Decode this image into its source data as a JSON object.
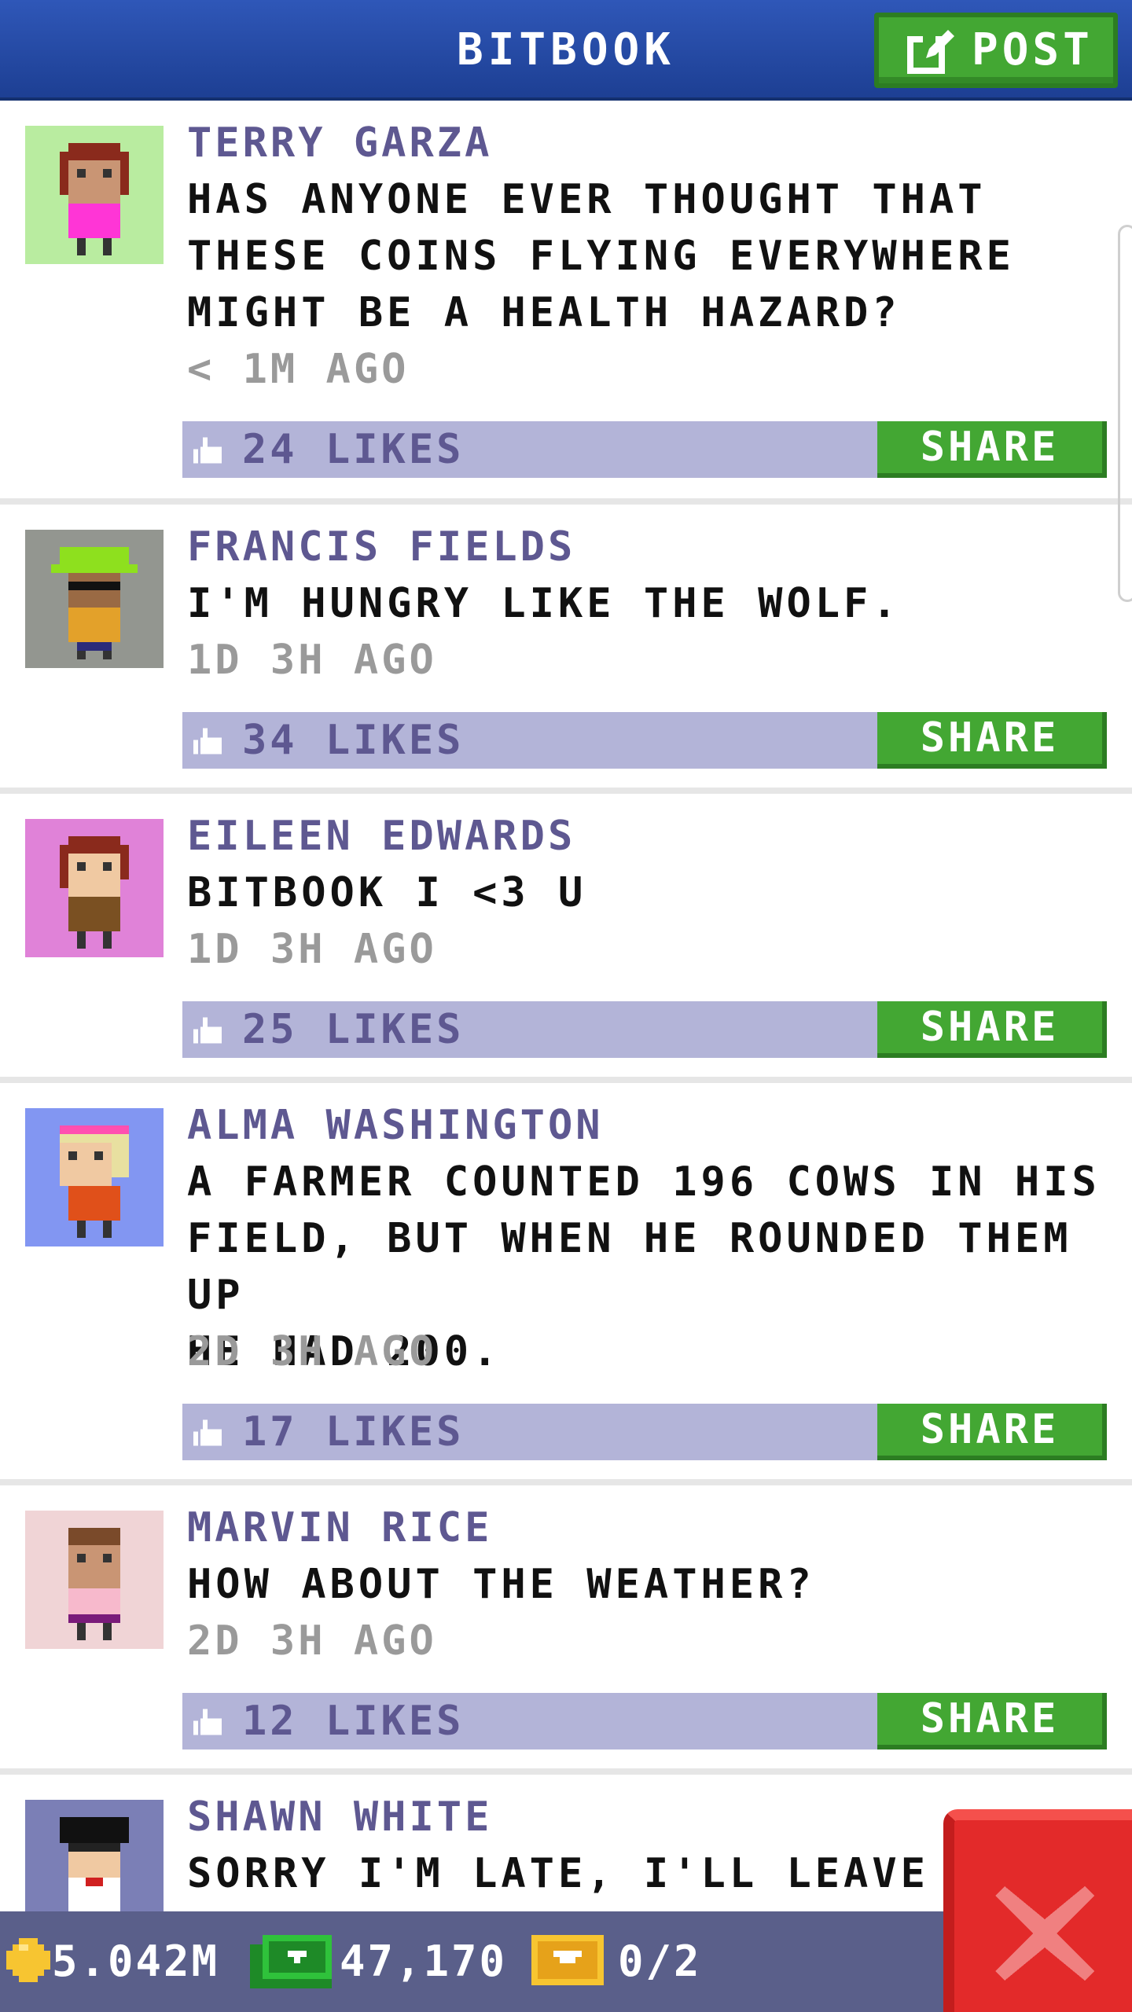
{
  "header": {
    "title": "BITBOOK",
    "post_label": "POST"
  },
  "colors": {
    "header_blue": "#2f57b8",
    "button_green": "#43a733",
    "author_purple": "#5e5891",
    "like_bar": "#b3b4d8",
    "time_gray": "#9a9a9a",
    "close_red": "#e32a2a"
  },
  "posts": [
    {
      "author": "TERRY GARZA",
      "message": "HAS ANYONE EVER THOUGHT THAT\nTHESE COINS FLYING EVERYWHERE\nMIGHT BE A HEALTH HAZARD?",
      "time": "< 1M AGO",
      "likes": "24 LIKES",
      "share": "SHARE",
      "avatar_bg": "#b9eca0"
    },
    {
      "author": "FRANCIS FIELDS",
      "message": "I'M HUNGRY LIKE THE WOLF.",
      "time": "1D 3H AGO",
      "likes": "34 LIKES",
      "share": "SHARE",
      "avatar_bg": "#939690"
    },
    {
      "author": "EILEEN EDWARDS",
      "message": "BITBOOK I <3 U",
      "time": "1D 3H AGO",
      "likes": "25 LIKES",
      "share": "SHARE",
      "avatar_bg": "#e082d8"
    },
    {
      "author": "ALMA WASHINGTON",
      "message": "A FARMER COUNTED 196 COWS IN HIS\nFIELD, BUT WHEN HE ROUNDED THEM UP\nHE HAD 200.",
      "time": "2D 3H AGO",
      "likes": "17 LIKES",
      "share": "SHARE",
      "avatar_bg": "#8296f2"
    },
    {
      "author": "MARVIN RICE",
      "message": "HOW ABOUT THE WEATHER?",
      "time": "2D 3H AGO",
      "likes": "12 LIKES",
      "share": "SHARE",
      "avatar_bg": "#f0d4d6"
    },
    {
      "author": "SHAWN WHITE",
      "message": "SORRY I'M LATE, I'LL LEAVE EARL",
      "avatar_bg": "#7b7fb6"
    }
  ],
  "status": {
    "coins": "5.042M",
    "bux": "47,170",
    "tickets": "0/2"
  },
  "icons": {
    "post": "edit-icon",
    "like": "thumb-up-icon",
    "coin": "coin-icon",
    "bux": "bux-icon",
    "ticket": "ticket-icon",
    "close": "close-icon"
  }
}
